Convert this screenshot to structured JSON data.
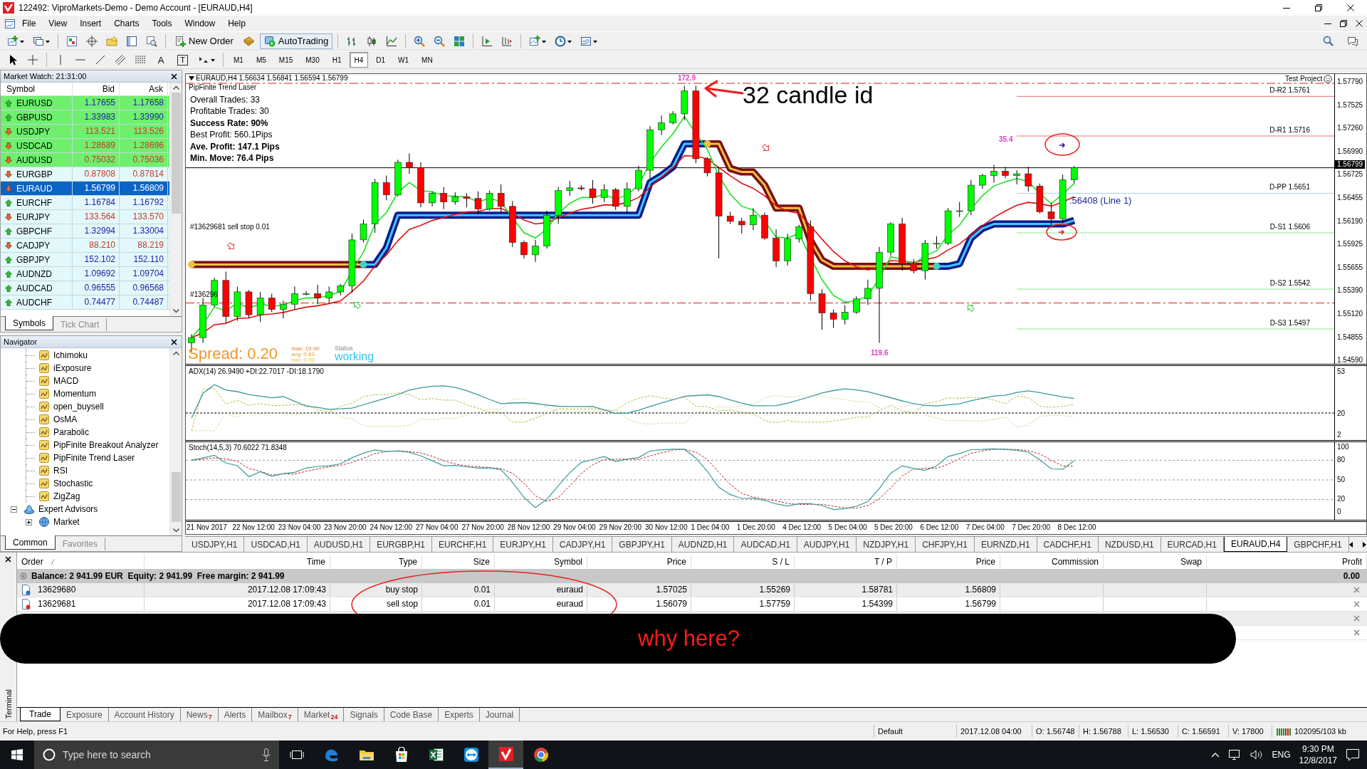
{
  "window": {
    "title": "122492: ViproMarkets-Demo - Demo Account - [EURAUD,H4]"
  },
  "menu": [
    "File",
    "View",
    "Insert",
    "Charts",
    "Tools",
    "Window",
    "Help"
  ],
  "toolbar": {
    "new_order": "New Order",
    "autotrading": "AutoTrading"
  },
  "drawing_tools": [
    {
      "glyph": "A",
      "kind": "plain"
    },
    {
      "glyph": "T",
      "kind": "boxed"
    }
  ],
  "timeframes": [
    {
      "label": "M1",
      "selected": false
    },
    {
      "label": "M5",
      "selected": false
    },
    {
      "label": "M15",
      "selected": false
    },
    {
      "label": "M30",
      "selected": false
    },
    {
      "label": "H1",
      "selected": false
    },
    {
      "label": "H4",
      "selected": true
    },
    {
      "label": "D1",
      "selected": false
    },
    {
      "label": "W1",
      "selected": false
    },
    {
      "label": "MN",
      "selected": false
    }
  ],
  "market_watch": {
    "title": "Market Watch: 21:31:00",
    "columns": [
      "Symbol",
      "Bid",
      "Ask"
    ],
    "rows": [
      {
        "symbol": "EURUSD",
        "bid": "1.17655",
        "ask": "1.17658",
        "rising": true,
        "highlighted": true,
        "selected": false
      },
      {
        "symbol": "GBPUSD",
        "bid": "1.33983",
        "ask": "1.33990",
        "rising": true,
        "highlighted": true,
        "selected": false
      },
      {
        "symbol": "USDJPY",
        "bid": "113.521",
        "ask": "113.526",
        "rising": false,
        "highlighted": true,
        "selected": false
      },
      {
        "symbol": "USDCAD",
        "bid": "1.28689",
        "ask": "1.28696",
        "rising": false,
        "highlighted": true,
        "selected": false
      },
      {
        "symbol": "AUDUSD",
        "bid": "0.75032",
        "ask": "0.75036",
        "rising": false,
        "highlighted": true,
        "selected": false
      },
      {
        "symbol": "EURGBP",
        "bid": "0.87808",
        "ask": "0.87814",
        "rising": false,
        "highlighted": false,
        "selected": false
      },
      {
        "symbol": "EURAUD",
        "bid": "1.56799",
        "ask": "1.56809",
        "rising": false,
        "highlighted": false,
        "selected": true
      },
      {
        "symbol": "EURCHF",
        "bid": "1.16784",
        "ask": "1.16792",
        "rising": true,
        "highlighted": false,
        "selected": false
      },
      {
        "symbol": "EURJPY",
        "bid": "133.564",
        "ask": "133.570",
        "rising": false,
        "highlighted": false,
        "selected": false
      },
      {
        "symbol": "GBPCHF",
        "bid": "1.32994",
        "ask": "1.33004",
        "rising": true,
        "highlighted": false,
        "selected": false
      },
      {
        "symbol": "CADJPY",
        "bid": "88.210",
        "ask": "88.219",
        "rising": false,
        "highlighted": false,
        "selected": false
      },
      {
        "symbol": "GBPJPY",
        "bid": "152.102",
        "ask": "152.110",
        "rising": true,
        "highlighted": false,
        "selected": false
      },
      {
        "symbol": "AUDNZD",
        "bid": "1.09692",
        "ask": "1.09704",
        "rising": true,
        "highlighted": false,
        "selected": false
      },
      {
        "symbol": "AUDCAD",
        "bid": "0.96555",
        "ask": "0.96568",
        "rising": true,
        "highlighted": false,
        "selected": false
      },
      {
        "symbol": "AUDCHF",
        "bid": "0.74477",
        "ask": "0.74487",
        "rising": true,
        "highlighted": false,
        "selected": false
      }
    ],
    "tabs": [
      {
        "label": "Symbols",
        "selected": true
      },
      {
        "label": "Tick Chart",
        "selected": false
      }
    ]
  },
  "navigator": {
    "title": "Navigator",
    "tree": [
      {
        "children": [
          {
            "label": "Ichimoku"
          },
          {
            "label": "iExposure"
          },
          {
            "label": "MACD"
          },
          {
            "label": "Momentum"
          },
          {
            "label": "open_buysell"
          },
          {
            "label": "OsMA"
          },
          {
            "label": "Parabolic"
          },
          {
            "label": "PipFinite Breakout Analyzer"
          },
          {
            "label": "PipFinite Trend Laser"
          },
          {
            "label": "RSI"
          },
          {
            "label": "Stochastic"
          },
          {
            "label": "ZigZag"
          }
        ]
      },
      {
        "label": "Expert Advisors",
        "expanded": true,
        "children": [
          {
            "label": "Market",
            "expanded": false
          }
        ]
      }
    ],
    "tabs": [
      {
        "label": "Common",
        "selected": true
      },
      {
        "label": "Favorites",
        "selected": false
      }
    ]
  },
  "chart": {
    "header": "EURAUD,H4 1.56634 1.56841 1.56594 1.56799",
    "indicator": "PipFinite Trend Laser",
    "stats": [
      {
        "text": "Overall Trades: 33",
        "bold": false
      },
      {
        "text": "Profitable Trades: 30",
        "bold": false
      },
      {
        "text": "Success Rate: 90%",
        "bold": true
      },
      {
        "text": "Best Profit: 560.1Pips",
        "bold": false
      },
      {
        "text": "Ave. Profit: 147.1 Pips",
        "bold": true
      },
      {
        "text": "Min. Move: 76.4 Pips",
        "bold": true
      }
    ],
    "order_labels": [
      "#13629681 sell stop 0.01",
      "#136296"
    ],
    "candle_labels": [
      "172.9",
      "35.4",
      "119.6"
    ],
    "spread": {
      "text": "Spread: 0.20",
      "stats": [
        "max: 19.90",
        "avg: 0.83",
        "min: 0.00"
      ],
      "status_label": "Status",
      "status": "working"
    },
    "corner_label": "Test Project",
    "pivots": [
      {
        "label": "D-R2 1.5761",
        "kind": "resistance"
      },
      {
        "label": "D-R1 1.5716",
        "kind": "resistance"
      },
      {
        "label": "D-PP 1.5651",
        "kind": "pivot"
      },
      {
        "label": "D-S1 1.5606",
        "kind": "support"
      },
      {
        "label": "D-S2 1.5542",
        "kind": "support"
      },
      {
        "label": "D-S3 1.5497",
        "kind": "support"
      }
    ],
    "line_label": ".56408 (Line 1)",
    "price_axis": [
      "1.57790",
      "1.57525",
      "1.57260",
      "1.56990",
      "1.56725",
      "1.56455",
      "1.56190",
      "1.55925",
      "1.55655",
      "1.55390",
      "1.55120",
      "1.54855",
      "1.54590"
    ],
    "current_price": "1.56799",
    "adx": {
      "label": "ADX(14) 26.9490 +DI:22.7017 -DI:18.1790",
      "axis": [
        "53",
        "20",
        "2"
      ]
    },
    "stochastic": {
      "label": "Stoch(14,5,3) 70.6022 71.8348",
      "axis": [
        "100",
        "80",
        "50",
        "20",
        "0"
      ]
    },
    "time_axis": [
      "21 Nov 2017",
      "22 Nov 12:00",
      "23 Nov 04:00",
      "23 Nov 20:00",
      "24 Nov 12:00",
      "27 Nov 04:00",
      "27 Nov 20:00",
      "28 Nov 12:00",
      "29 Nov 04:00",
      "29 Nov 20:00",
      "30 Nov 12:00",
      "1 Dec 04:00",
      "1 Dec 20:00",
      "4 Dec 12:00",
      "5 Dec 04:00",
      "5 Dec 20:00",
      "6 Dec 12:00",
      "7 Dec 04:00",
      "7 Dec 20:00",
      "8 Dec 12:00"
    ]
  },
  "chart_tabs": [
    {
      "label": "USDJPY,H1",
      "selected": false
    },
    {
      "label": "USDCAD,H1",
      "selected": false
    },
    {
      "label": "AUDUSD,H1",
      "selected": false
    },
    {
      "label": "EURGBP,H1",
      "selected": false
    },
    {
      "label": "EURCHF,H1",
      "selected": false
    },
    {
      "label": "EURJPY,H1",
      "selected": false
    },
    {
      "label": "CADJPY,H1",
      "selected": false
    },
    {
      "label": "GBPJPY,H1",
      "selected": false
    },
    {
      "label": "AUDNZD,H1",
      "selected": false
    },
    {
      "label": "AUDCAD,H1",
      "selected": false
    },
    {
      "label": "AUDJPY,H1",
      "selected": false
    },
    {
      "label": "NZDJPY,H1",
      "selected": false
    },
    {
      "label": "CHFJPY,H1",
      "selected": false
    },
    {
      "label": "EURNZD,H1",
      "selected": false
    },
    {
      "label": "CADCHF,H1",
      "selected": false
    },
    {
      "label": "NZDUSD,H1",
      "selected": false
    },
    {
      "label": "EURCAD,H1",
      "selected": false
    },
    {
      "label": "EURAUD,H4",
      "selected": true
    },
    {
      "label": "GBPCHF,H1",
      "selected": false
    }
  ],
  "annotations": {
    "arrow_note": "32 candle id",
    "question": "why here?"
  },
  "terminal": {
    "title": "Terminal",
    "columns": [
      "Order",
      "Time",
      "Type",
      "Size",
      "Symbol",
      "Price",
      "S / L",
      "T / P",
      "Price",
      "Commission",
      "Swap",
      "Profit"
    ],
    "balance": "Balance: 2 941.99 EUR  Equity: 2 941.99  Free margin: 2 941.99",
    "balance_profit": "0.00",
    "orders": [
      {
        "covered": false,
        "kind": "buy",
        "cells": [
          "13629680",
          "2017.12.08 17:09:43",
          "buy stop",
          "0.01",
          "euraud",
          "1.57025",
          "1.55269",
          "1.58781",
          "1.56809"
        ]
      },
      {
        "covered": false,
        "kind": "sell",
        "cells": [
          "13629681",
          "2017.12.08 17:09:43",
          "sell stop",
          "0.01",
          "euraud",
          "1.56079",
          "1.57759",
          "1.54399",
          "1.56799"
        ]
      },
      {
        "covered": true
      },
      {
        "covered": true
      }
    ],
    "tabs": [
      {
        "label": "Trade",
        "selected": true
      },
      {
        "label": "Exposure",
        "selected": false
      },
      {
        "label": "Account History",
        "selected": false
      },
      {
        "label": "News",
        "badge": "7",
        "selected": false
      },
      {
        "label": "Alerts",
        "selected": false
      },
      {
        "label": "Mailbox",
        "badge": "7",
        "selected": false
      },
      {
        "label": "Market",
        "badge": "24",
        "selected": false
      },
      {
        "label": "Signals",
        "selected": false
      },
      {
        "label": "Code Base",
        "selected": false
      },
      {
        "label": "Experts",
        "selected": false
      },
      {
        "label": "Journal",
        "selected": false
      }
    ]
  },
  "status_bar": {
    "help": "For Help, press F1",
    "profile": "Default",
    "fields": [
      "2017.12.08 04:00",
      "O: 1.56748",
      "H: 1.56788",
      "L: 1.56530",
      "C: 1.56591",
      "V: 17800"
    ],
    "traffic": "102095/103 kb"
  },
  "taskbar": {
    "search_placeholder": "Type here to search",
    "language": "ENG",
    "time": "9:30 PM",
    "date": "12/8/2017"
  }
}
